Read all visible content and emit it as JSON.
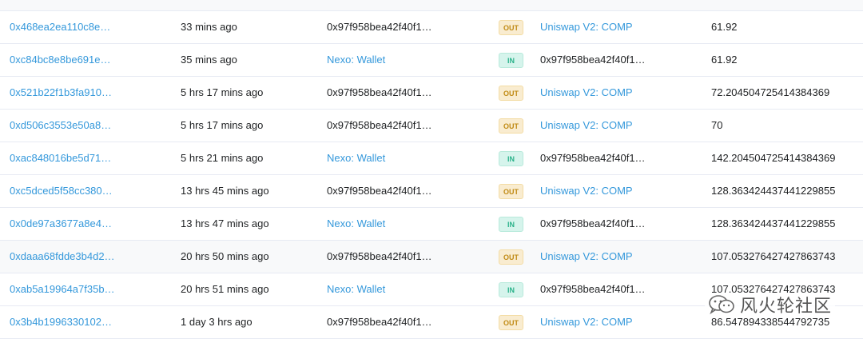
{
  "header": {
    "cols": [
      "",
      "",
      "",
      "",
      "",
      ""
    ]
  },
  "rows": [
    {
      "txn": "0x468ea2ea110c8e…",
      "age": "33 mins ago",
      "from": "0x97f958bea42f40f1…",
      "from_link": false,
      "dir": "OUT",
      "to": "Uniswap V2: COMP",
      "to_link": true,
      "qty": "61.92"
    },
    {
      "txn": "0xc84bc8e8be691e…",
      "age": "35 mins ago",
      "from": "Nexo: Wallet",
      "from_link": true,
      "dir": "IN",
      "to": "0x97f958bea42f40f1…",
      "to_link": false,
      "qty": "61.92"
    },
    {
      "txn": "0x521b22f1b3fa910…",
      "age": "5 hrs 17 mins ago",
      "from": "0x97f958bea42f40f1…",
      "from_link": false,
      "dir": "OUT",
      "to": "Uniswap V2: COMP",
      "to_link": true,
      "qty": "72.204504725414384369"
    },
    {
      "txn": "0xd506c3553e50a8…",
      "age": "5 hrs 17 mins ago",
      "from": "0x97f958bea42f40f1…",
      "from_link": false,
      "dir": "OUT",
      "to": "Uniswap V2: COMP",
      "to_link": true,
      "qty": "70"
    },
    {
      "txn": "0xac848016be5d71…",
      "age": "5 hrs 21 mins ago",
      "from": "Nexo: Wallet",
      "from_link": true,
      "dir": "IN",
      "to": "0x97f958bea42f40f1…",
      "to_link": false,
      "qty": "142.204504725414384369"
    },
    {
      "txn": "0xc5dced5f58cc380…",
      "age": "13 hrs 45 mins ago",
      "from": "0x97f958bea42f40f1…",
      "from_link": false,
      "dir": "OUT",
      "to": "Uniswap V2: COMP",
      "to_link": true,
      "qty": "128.363424437441229855"
    },
    {
      "txn": "0x0de97a3677a8e4…",
      "age": "13 hrs 47 mins ago",
      "from": "Nexo: Wallet",
      "from_link": true,
      "dir": "IN",
      "to": "0x97f958bea42f40f1…",
      "to_link": false,
      "qty": "128.363424437441229855"
    },
    {
      "txn": "0xdaaa68fdde3b4d2…",
      "age": "20 hrs 50 mins ago",
      "from": "0x97f958bea42f40f1…",
      "from_link": false,
      "dir": "OUT",
      "to": "Uniswap V2: COMP",
      "to_link": true,
      "qty": "107.053276427427863743",
      "highlight": true
    },
    {
      "txn": "0xab5a19964a7f35b…",
      "age": "20 hrs 51 mins ago",
      "from": "Nexo: Wallet",
      "from_link": true,
      "dir": "IN",
      "to": "0x97f958bea42f40f1…",
      "to_link": false,
      "qty": "107.053276427427863743"
    },
    {
      "txn": "0x3b4b1996330102…",
      "age": "1 day 3 hrs ago",
      "from": "0x97f958bea42f40f1…",
      "from_link": false,
      "dir": "OUT",
      "to": "Uniswap V2: COMP",
      "to_link": true,
      "qty": "86.547894338544792735"
    }
  ],
  "watermark": {
    "text": "风火轮社区",
    "icon": "wechat-icon"
  },
  "colors": {
    "link": "#3498db",
    "out_badge_bg": "#f9ecd0",
    "in_badge_bg": "#d6f4ec"
  }
}
